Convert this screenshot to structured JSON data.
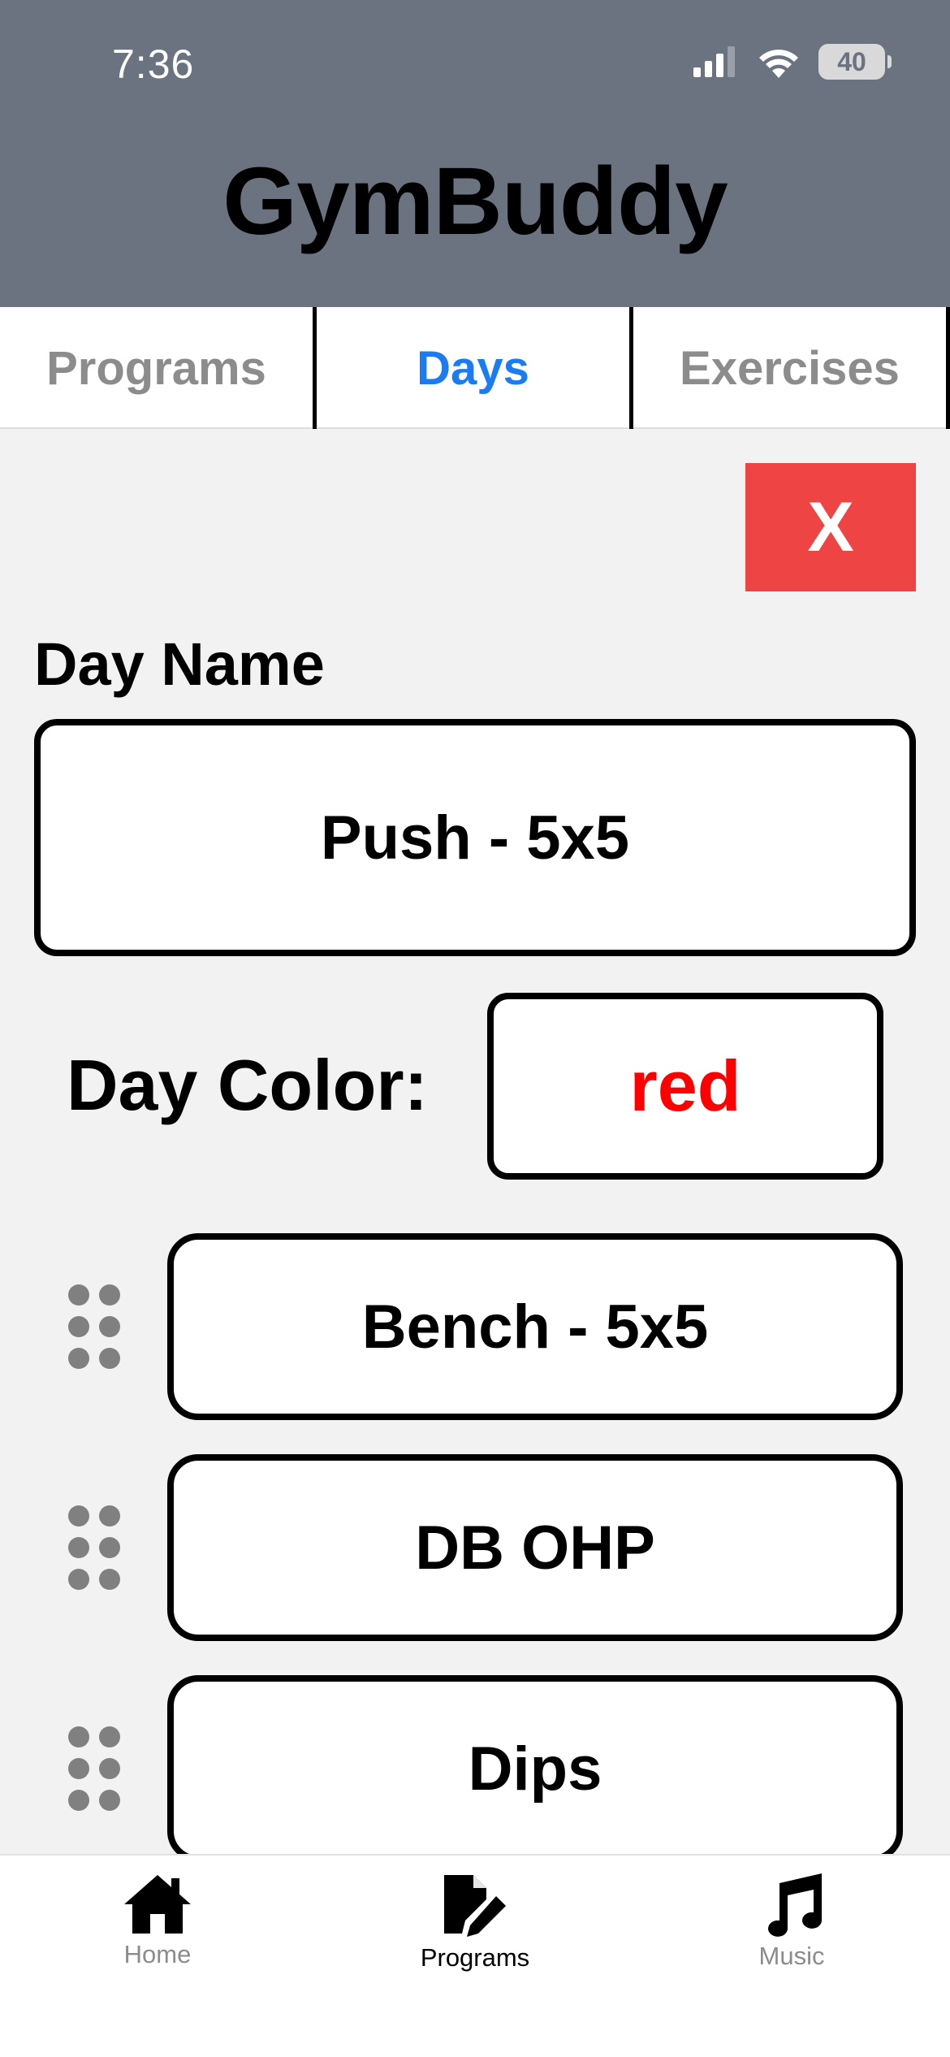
{
  "status_bar": {
    "time": "7:36",
    "battery": "40"
  },
  "header": {
    "title": "GymBuddy"
  },
  "tabs": [
    {
      "label": "Programs",
      "active": false
    },
    {
      "label": "Days",
      "active": true
    },
    {
      "label": "Exercises",
      "active": false
    }
  ],
  "close_button": {
    "label": "X"
  },
  "day_name": {
    "label": "Day Name",
    "value": "Push - 5x5"
  },
  "day_color": {
    "label": "Day Color:",
    "value": "red"
  },
  "exercises": [
    {
      "name": "Bench - 5x5"
    },
    {
      "name": "DB OHP"
    },
    {
      "name": "Dips"
    }
  ],
  "bottom_nav": [
    {
      "label": "Home",
      "icon": "home-icon",
      "active": false
    },
    {
      "label": "Programs",
      "icon": "edit-document-icon",
      "active": true
    },
    {
      "label": "Music",
      "icon": "music-note-icon",
      "active": false
    }
  ],
  "colors": {
    "header_bg": "#6b7280",
    "active_tab": "#1a7cf0",
    "close_bg": "#ef4444",
    "day_color_text": "#ff0000"
  }
}
